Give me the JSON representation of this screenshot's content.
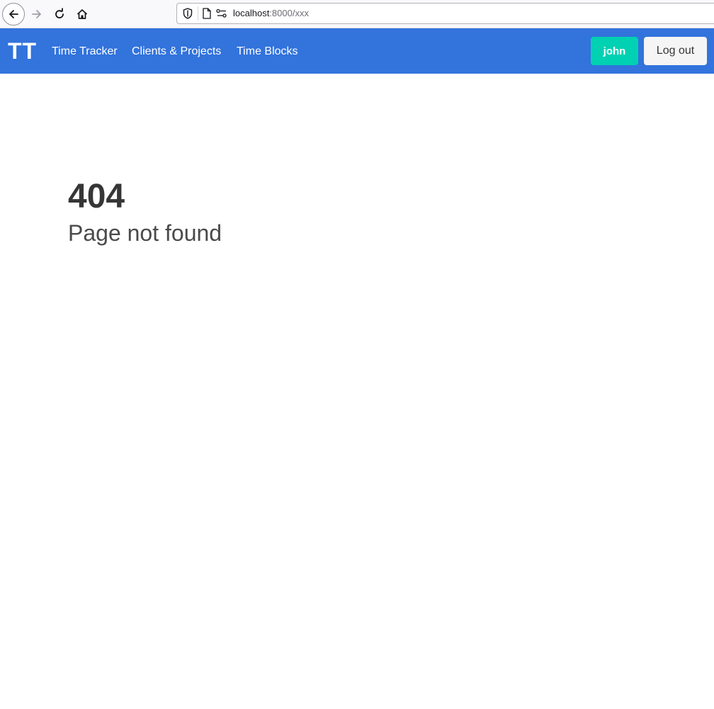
{
  "browser": {
    "url_host": "localhost",
    "url_rest": ":8000/xxx",
    "icons": [
      "back-arrow-icon",
      "forward-arrow-icon",
      "reload-icon",
      "home-icon",
      "shield-icon",
      "page-icon",
      "permissions-icon"
    ]
  },
  "navbar": {
    "brand": "TT",
    "links": [
      {
        "label": "Time Tracker"
      },
      {
        "label": "Clients & Projects"
      },
      {
        "label": "Time Blocks"
      }
    ],
    "user_button": "john",
    "logout_button": "Log out",
    "colors": {
      "navbar_bg": "#3273dc",
      "user_button_bg": "#00d1b2",
      "logout_button_bg": "#f5f5f5"
    }
  },
  "main": {
    "code": "404",
    "message": "Page not found"
  }
}
